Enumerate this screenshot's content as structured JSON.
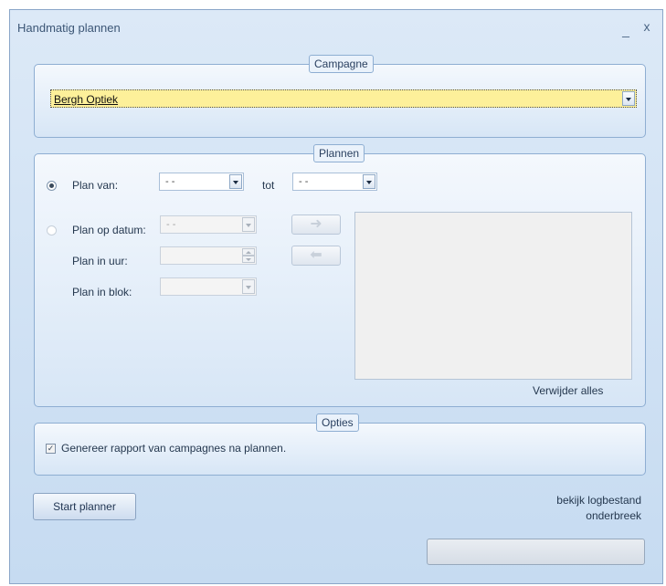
{
  "window": {
    "title": "Handmatig plannen",
    "minimize_glyph": "_",
    "close_glyph": "x"
  },
  "campagne": {
    "legend": "Campagne",
    "selected": "Bergh Optiek"
  },
  "plannen": {
    "legend": "Plannen",
    "plan_van_label": "Plan van:",
    "plan_van_value": "- -",
    "tot_label": "tot",
    "tot_value": "- -",
    "plan_op_datum_label": "Plan op datum:",
    "plan_op_datum_value": "- -",
    "plan_in_uur_label": "Plan in uur:",
    "plan_in_blok_label": "Plan in blok:",
    "add_arrow": "➜",
    "remove_arrow": "⬅",
    "verwijder_alles": "Verwijder alles",
    "selected_mode": "plan_van"
  },
  "opties": {
    "legend": "Opties",
    "genereer_label": "Genereer rapport van campagnes na plannen.",
    "genereer_checked": true,
    "check_glyph": "✓"
  },
  "footer": {
    "start_planner": "Start planner",
    "bekijk_logbestand": "bekijk logbestand",
    "onderbreek": "onderbreek",
    "progress": 0
  }
}
